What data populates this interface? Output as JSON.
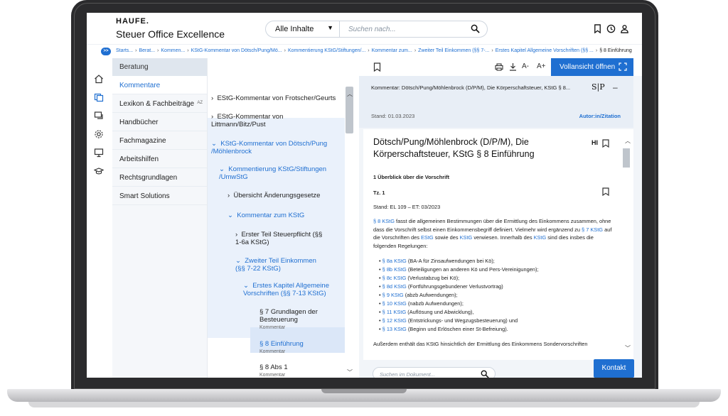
{
  "header": {
    "logo": "HAUFE.",
    "app_title": "Steuer Office Excellence",
    "scope_select": "Alle Inhalte",
    "search_placeholder": "Suchen nach..."
  },
  "breadcrumb": {
    "toggle": ">>",
    "items": [
      "Starts...",
      "Berat...",
      "Kommen...",
      "KStG-Kommentar von Dötsch/Pung/Mö...",
      "Kommentierung KStG/Stiftungen/...",
      "Kommentar zum...",
      "Zweiter Teil Einkommen (§§ 7-...",
      "Erstes Kapitel Allgemeine Vorschriften (§§ ..."
    ],
    "current": "§ 8 Einführung"
  },
  "leftnav": {
    "header": "Beratung",
    "items": [
      "Kommentare",
      "Lexikon & Fachbeiträge",
      "Handbücher",
      "Fachmagazine",
      "Arbeitshilfen",
      "Rechtsgrundlagen",
      "Smart Solutions"
    ],
    "az_badge": "AZ"
  },
  "tree": {
    "n1": "EStG-Kommentar von Frotscher/Geurts",
    "n2": "EStG-Kommentar von Littmann/Bitz/Pust",
    "n3": "KStG-Kommentar von Dötsch/Pung /Möhlenbrock",
    "n4": "Kommentierung KStG/Stiftungen /UmwStG",
    "n5": "Übersicht Änderungsgesetze",
    "n6": "Kommentar zum KStG",
    "n7": "Erster Teil Steuerpflicht (§§ 1-6a KStG)",
    "n8": "Zweiter Teil Einkommen (§§ 7-22 KStG)",
    "n9": "Erstes Kapitel Allgemeine Vorschriften (§§ 7-13 KStG)",
    "n10": "§ 7 Grundlagen der Besteuerung",
    "n11": "§ 8 Einführung",
    "n12": "§ 8 Abs 1",
    "sub": "Kommentar"
  },
  "doc": {
    "vollansicht": "Vollansicht öffnen",
    "meta_line": "Kommentar: Dötsch/Pung/Möhlenbrock (D/P/M), Die Körperschaftsteuer, KStG § 8...",
    "sp_logo": "S|P",
    "stand_meta": "Stand: 01.03.2023",
    "autor": "Autor:in/Zitation",
    "title": "Dötsch/Pung/Möhlenbrock (D/P/M), Die Körperschaftsteuer, KStG § 8 Einführung",
    "hl": "HI",
    "section": "1 Überblick über die Vorschrift",
    "tz": "Tz. 1",
    "stand_el": "Stand: EL 109 – ET: 03/2023",
    "p1_link1": "§ 8 KStG",
    "p1_a": " fasst die allgemeinen Bestimmungen über die Ermittlung des Einkommens zusammen, ohne dass die Vorschrift selbst einen Einkommensbegriff definiert. Vielmehr wird ergänzend zu ",
    "p1_link2": "§ 7 KStG",
    "p1_b": " auf die Vorschriften des ",
    "p1_link3": "EStG",
    "p1_c": " sowie des ",
    "p1_link4": "KStG",
    "p1_d": " verwiesen. Innerhalb des ",
    "p1_link5": "KStG",
    "p1_e": " sind dies insbes die folgenden Regelungen:",
    "bullets": [
      {
        "link": "§ 8a KStG",
        "text": " (BA-A für Zinsaufwendungen bei Kö);"
      },
      {
        "link": "§ 8b KStG",
        "text": " (Beteiligungen an anderen Kö und Pers-Vereinigungen);"
      },
      {
        "link": "§ 8c KStG",
        "text": " (Verlustabzug bei Kö);"
      },
      {
        "link": "§ 8d KStG",
        "text": " (Fortführungsgebundener Verlustvortrag)"
      },
      {
        "link": "§ 9 KStG",
        "text": " (abzb Aufwendungen);"
      },
      {
        "link": "§ 10 KStG",
        "text": " (nabzb Aufwendungen);"
      },
      {
        "link": "§ 11 KStG",
        "text": " (Auflösung und Abwicklung),"
      },
      {
        "link": "§ 12 KStG",
        "text": " (Entstrickungs- und Wegzugsbesteuerung) und"
      },
      {
        "link": "§ 13 KStG",
        "text": " (Beginn und Erlöschen einer St-Befreiung)."
      }
    ],
    "p2": "Außerdem enthält das KStG hinsichtlich der Ermittlung des Einkommens Sondervorschriften",
    "search_placeholder": "Suchen im Dokument...",
    "kontakt": "Kontakt"
  }
}
